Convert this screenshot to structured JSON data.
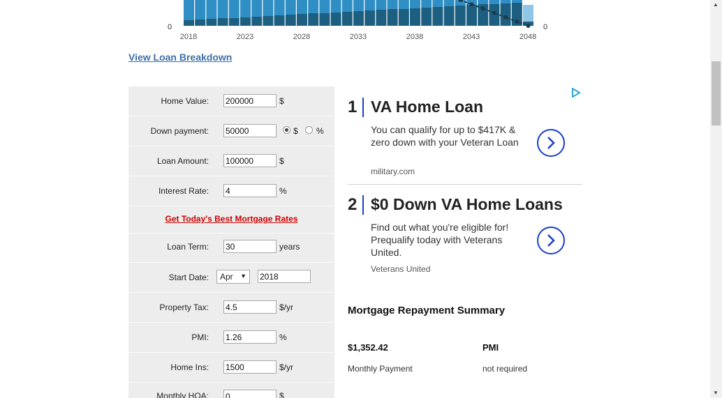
{
  "chart_data": {
    "type": "bar",
    "x_ticks": [
      "2018",
      "2023",
      "2028",
      "2033",
      "2038",
      "2043",
      "2048"
    ],
    "left_axis_visible_tick": "0",
    "right_axis_visible_tick": "0",
    "colors": {
      "principal": "#1c5f80",
      "interest": "#2f8fc4",
      "last_year": "#8fc6e6",
      "balance_line": "#1f3a4a"
    }
  },
  "view_loan_breakdown": "View Loan Breakdown",
  "form": {
    "home_value": {
      "label": "Home Value:",
      "value": "200000",
      "unit": "$"
    },
    "down_payment": {
      "label": "Down payment:",
      "value": "50000",
      "unit_dollar": "$",
      "unit_percent": "%",
      "selected": "$"
    },
    "loan_amount": {
      "label": "Loan Amount:",
      "value": "100000",
      "unit": "$"
    },
    "interest_rate": {
      "label": "Interest Rate:",
      "value": "4",
      "unit": "%"
    },
    "rates_link": "Get Today's Best Mortgage Rates",
    "loan_term": {
      "label": "Loan Term:",
      "value": "30",
      "unit": "years"
    },
    "start_date": {
      "label": "Start Date:",
      "month": "Apr",
      "year": "2018"
    },
    "property_tax": {
      "label": "Property Tax:",
      "value": "4.5",
      "unit": "$/yr"
    },
    "pmi": {
      "label": "PMI:",
      "value": "1.26",
      "unit": "%"
    },
    "home_ins": {
      "label": "Home Ins:",
      "value": "1500",
      "unit": "$/yr"
    },
    "monthly_hoa": {
      "label": "Monthly HOA:",
      "value": "0",
      "unit": "$"
    }
  },
  "ads": [
    {
      "number": "1",
      "title": "VA Home Loan",
      "text": "You can qualify for up to $417K & zero down with your Veteran Loan",
      "source": "military.com"
    },
    {
      "number": "2",
      "title": "$0 Down VA Home Loans",
      "text": "Find out what you're eligible for! Prequalify today with Veterans United.",
      "source": "Veterans United"
    }
  ],
  "summary": {
    "title": "Mortgage Repayment Summary",
    "monthly_payment_value": "$1,352.42",
    "monthly_payment_label": "Monthly Payment",
    "pmi_value": "PMI",
    "pmi_label": "not required"
  }
}
